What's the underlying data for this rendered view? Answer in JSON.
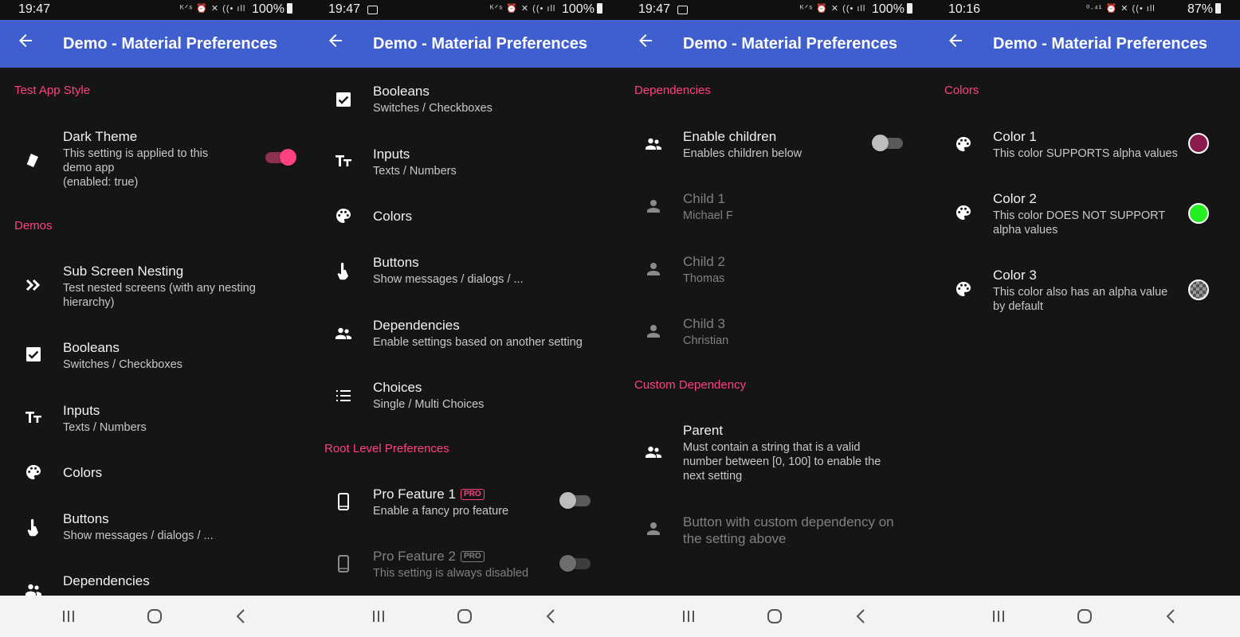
{
  "screens": [
    {
      "status": {
        "time": "19:47",
        "icons": "ᴷᐟˢ ⏰ ✕ ((• ıll",
        "battery": "100%"
      },
      "appbar_title": "Demo - Material Preferences",
      "sections": [
        {
          "label": "Test App Style"
        },
        {
          "label": "Demos"
        }
      ],
      "items": [
        {
          "title": "Dark Theme",
          "summary": "This setting is applied to this\ndemo app\n(enabled: true)",
          "icon": "theme-icon"
        },
        {
          "title": "Sub Screen Nesting",
          "summary": "Test nested screens (with any nesting\nhierarchy)",
          "icon": "double-chevron-icon"
        },
        {
          "title": "Booleans",
          "summary": "Switches / Checkboxes",
          "icon": "checkbox-icon"
        },
        {
          "title": "Inputs",
          "summary": "Texts / Numbers",
          "icon": "text-size-icon"
        },
        {
          "title": "Colors",
          "summary": "",
          "icon": "palette-icon"
        },
        {
          "title": "Buttons",
          "summary": "Show messages / dialogs / ...",
          "icon": "touch-icon"
        },
        {
          "title": "Dependencies",
          "summary": "",
          "icon": "people-icon"
        }
      ]
    },
    {
      "status": {
        "time": "19:47",
        "icons": "ᴷᐟˢ ⏰ ✕ ((• ıll",
        "battery": "100%"
      },
      "appbar_title": "Demo - Material Preferences",
      "sections": [
        {
          "label": "Root Level Preferences"
        }
      ],
      "items": [
        {
          "title": "Booleans",
          "summary": "Switches / Checkboxes",
          "icon": "checkbox-icon"
        },
        {
          "title": "Inputs",
          "summary": "Texts / Numbers",
          "icon": "text-size-icon"
        },
        {
          "title": "Colors",
          "summary": "",
          "icon": "palette-icon"
        },
        {
          "title": "Buttons",
          "summary": "Show messages / dialogs / ...",
          "icon": "touch-icon"
        },
        {
          "title": "Dependencies",
          "summary": "Enable settings based on another setting",
          "icon": "people-icon"
        },
        {
          "title": "Choices",
          "summary": "Single / Multi Choices",
          "icon": "list-icon"
        },
        {
          "title": "Pro Feature 1",
          "badge": "PRO",
          "summary": "Enable a fancy pro feature",
          "icon": "phone-icon"
        },
        {
          "title": "Pro Feature 2",
          "badge": "PRO",
          "summary": "This setting is always disabled",
          "icon": "phone-icon"
        }
      ]
    },
    {
      "status": {
        "time": "19:47",
        "icons": "ᴷᐟˢ ⏰ ✕ ((• ıll",
        "battery": "100%"
      },
      "appbar_title": "Demo - Material Preferences",
      "sections": [
        {
          "label": "Dependencies"
        },
        {
          "label": "Custom Dependency"
        }
      ],
      "items": [
        {
          "title": "Enable children",
          "summary": "Enables children below",
          "icon": "people-icon"
        },
        {
          "title": "Child 1",
          "summary": "Michael F",
          "icon": "person-icon"
        },
        {
          "title": "Child 2",
          "summary": "Thomas",
          "icon": "person-icon"
        },
        {
          "title": "Child 3",
          "summary": "Christian",
          "icon": "person-icon"
        },
        {
          "title": "Parent",
          "summary": "Must contain a string that is a valid\nnumber between [0, 100] to enable the\nnext setting",
          "icon": "people-icon"
        },
        {
          "title": "Button with custom dependency on\nthe setting above",
          "summary": "",
          "icon": "person-icon"
        }
      ]
    },
    {
      "status": {
        "time": "10:16",
        "icons": "⁰·⁴¹ ⏰ ✕ ((• ıll",
        "battery": "87%"
      },
      "appbar_title": "Demo - Material Preferences",
      "sections": [
        {
          "label": "Colors"
        }
      ],
      "items": [
        {
          "title": "Color 1",
          "summary": "This color SUPPORTS alpha values",
          "icon": "palette-icon",
          "color": "#8b1a4f"
        },
        {
          "title": "Color 2",
          "summary": "This color DOES NOT SUPPORT\nalpha values",
          "icon": "palette-icon",
          "color": "#22ee22"
        },
        {
          "title": "Color 3",
          "summary": "This color also has an alpha value\nby default",
          "icon": "palette-icon",
          "color": "#7a7a7a"
        }
      ]
    }
  ],
  "colors": {
    "accent": "#ff4081",
    "appbar": "#3f5fcf",
    "background": "#151515"
  }
}
